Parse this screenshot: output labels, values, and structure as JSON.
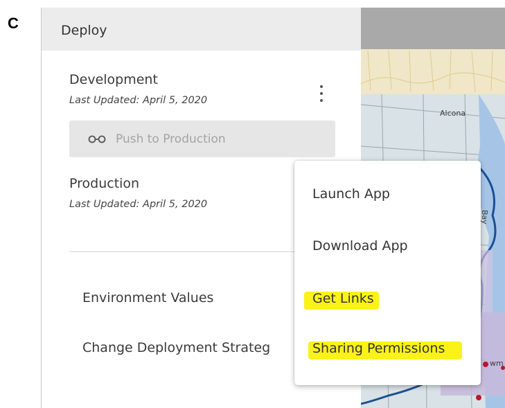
{
  "panel_label": "C",
  "sidebar": {
    "title": "Deploy",
    "environments": [
      {
        "name": "Development",
        "last_updated": "Last Updated: April 5, 2020"
      },
      {
        "name": "Production",
        "last_updated": "Last Updated: April 5, 2020"
      }
    ],
    "push_button_label": "Push to Production",
    "links": [
      "Environment Values",
      "Change Deployment Strateg"
    ]
  },
  "context_menu": {
    "items": [
      "Launch App",
      "Download App",
      "Get Links",
      "Sharing Permissions"
    ],
    "highlight_color": "#fbf21a"
  },
  "map": {
    "labels": [
      "Alcona",
      "Bay",
      "wm"
    ]
  }
}
